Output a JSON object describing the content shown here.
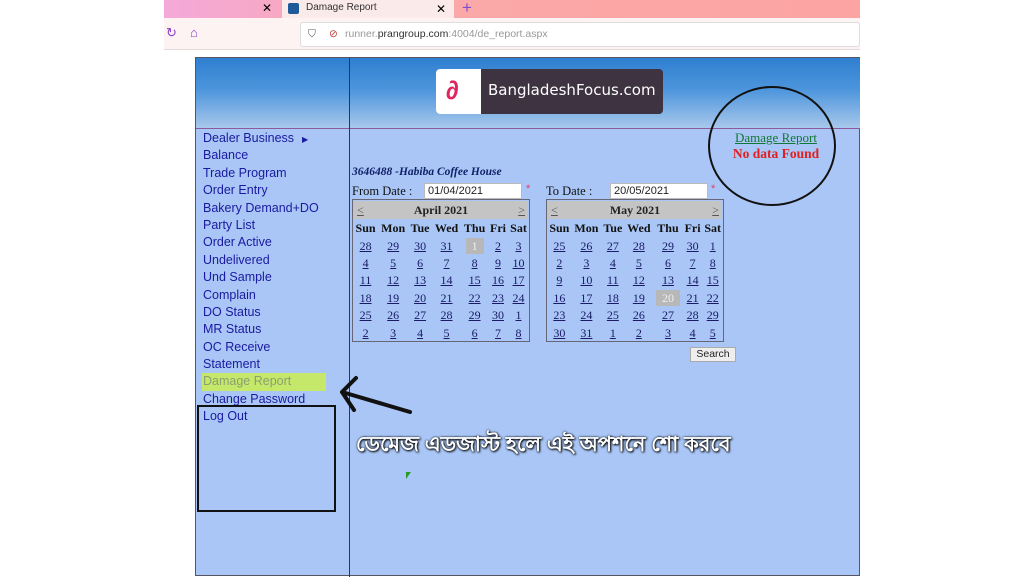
{
  "browser": {
    "tab_title": "Damage Report",
    "url_prefix": "runner.",
    "url_domain": "prangroup.com",
    "url_path": ":4004/de_report.aspx"
  },
  "logo": {
    "text": "BangladeshFocus.com"
  },
  "sidebar": {
    "items": [
      "Dealer Business",
      "Balance",
      "Trade Program",
      "Order Entry",
      "Bakery Demand+DO",
      "Party List",
      "Order Active",
      "Undelivered",
      "Und Sample",
      "Complain",
      "DO Status",
      "MR Status",
      "OC Receive",
      "Statement",
      "Damage Report",
      "Change Password",
      "Log Out"
    ],
    "active": "Damage Report"
  },
  "main": {
    "party": "3646488 -Habiba Coffee House",
    "from_label": "From Date :",
    "from_value": "01/04/2021",
    "to_label": "To Date :",
    "to_value": "20/05/2021",
    "required": "*",
    "search_label": "Search",
    "report_link": "Damage Report",
    "message": "No data Found",
    "annotation": "ডেমেজ এডজাস্ট হলে এই অপশনে শো করবে"
  },
  "calendars": [
    {
      "title": "April 2021",
      "prev": "<",
      "next": ">",
      "days": [
        "Sun",
        "Mon",
        "Tue",
        "Wed",
        "Thu",
        "Fri",
        "Sat"
      ],
      "selected": "1",
      "weeks": [
        [
          "28",
          "29",
          "30",
          "31",
          "1",
          "2",
          "3"
        ],
        [
          "4",
          "5",
          "6",
          "7",
          "8",
          "9",
          "10"
        ],
        [
          "11",
          "12",
          "13",
          "14",
          "15",
          "16",
          "17"
        ],
        [
          "18",
          "19",
          "20",
          "21",
          "22",
          "23",
          "24"
        ],
        [
          "25",
          "26",
          "27",
          "28",
          "29",
          "30",
          "1"
        ],
        [
          "2",
          "3",
          "4",
          "5",
          "6",
          "7",
          "8"
        ]
      ]
    },
    {
      "title": "May 2021",
      "prev": "<",
      "next": ">",
      "days": [
        "Sun",
        "Mon",
        "Tue",
        "Wed",
        "Thu",
        "Fri",
        "Sat"
      ],
      "selected": "20",
      "weeks": [
        [
          "25",
          "26",
          "27",
          "28",
          "29",
          "30",
          "1"
        ],
        [
          "2",
          "3",
          "4",
          "5",
          "6",
          "7",
          "8"
        ],
        [
          "9",
          "10",
          "11",
          "12",
          "13",
          "14",
          "15"
        ],
        [
          "16",
          "17",
          "18",
          "19",
          "20",
          "21",
          "22"
        ],
        [
          "23",
          "24",
          "25",
          "26",
          "27",
          "28",
          "29"
        ],
        [
          "30",
          "31",
          "1",
          "2",
          "3",
          "4",
          "5"
        ]
      ]
    }
  ]
}
